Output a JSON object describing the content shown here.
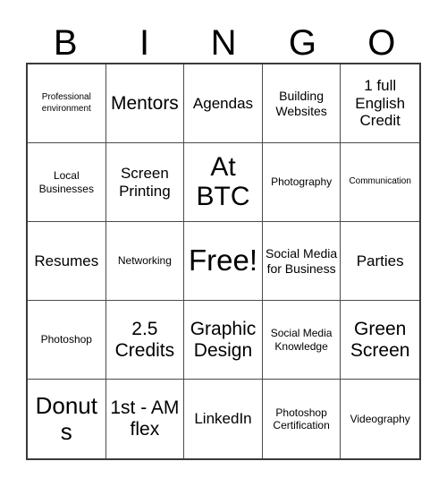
{
  "card": {
    "type": "bingo-card",
    "columns": 5,
    "rows": 5,
    "background_color": "#ffffff",
    "text_color": "#000000",
    "border_color": "#4a4a4a",
    "outer_border_color": "#3a3a3a",
    "header": {
      "letters": [
        "B",
        "I",
        "N",
        "G",
        "O"
      ]
    },
    "free_space": {
      "label": "Free!",
      "row": 3,
      "column": 3
    },
    "cells": [
      {
        "text": "Professional environment",
        "size": "sz-xs",
        "row": 1,
        "column": 1,
        "column_letter": "B"
      },
      {
        "text": "Mentors",
        "size": "sz-xl",
        "row": 1,
        "column": 2,
        "column_letter": "I"
      },
      {
        "text": "Agendas",
        "size": "sz-l",
        "row": 1,
        "column": 3,
        "column_letter": "N"
      },
      {
        "text": "Building Websites",
        "size": "sz-m",
        "row": 1,
        "column": 4,
        "column_letter": "G"
      },
      {
        "text": "1 full English Credit",
        "size": "sz-l",
        "row": 1,
        "column": 5,
        "column_letter": "O"
      },
      {
        "text": "Local Businesses",
        "size": "sz-s",
        "row": 2,
        "column": 1,
        "column_letter": "B"
      },
      {
        "text": "Screen Printing",
        "size": "sz-l",
        "row": 2,
        "column": 2,
        "column_letter": "I"
      },
      {
        "text": "At BTC",
        "size": "sz-3xl",
        "row": 2,
        "column": 3,
        "column_letter": "N"
      },
      {
        "text": "Photography",
        "size": "sz-s",
        "row": 2,
        "column": 4,
        "column_letter": "G"
      },
      {
        "text": "Communication",
        "size": "sz-xs",
        "row": 2,
        "column": 5,
        "column_letter": "O"
      },
      {
        "text": "Resumes",
        "size": "sz-l",
        "row": 3,
        "column": 1,
        "column_letter": "B"
      },
      {
        "text": "Networking",
        "size": "sz-s",
        "row": 3,
        "column": 2,
        "column_letter": "I"
      },
      {
        "text": "Free!",
        "size": "sz-4xl",
        "row": 3,
        "column": 3,
        "column_letter": "N"
      },
      {
        "text": "Social Media for Business",
        "size": "sz-m",
        "row": 3,
        "column": 4,
        "column_letter": "G"
      },
      {
        "text": "Parties",
        "size": "sz-l",
        "row": 3,
        "column": 5,
        "column_letter": "O"
      },
      {
        "text": "Photoshop",
        "size": "sz-s",
        "row": 4,
        "column": 1,
        "column_letter": "B"
      },
      {
        "text": "2.5 Credits",
        "size": "sz-xl",
        "row": 4,
        "column": 2,
        "column_letter": "I"
      },
      {
        "text": "Graphic Design",
        "size": "sz-xl",
        "row": 4,
        "column": 3,
        "column_letter": "N"
      },
      {
        "text": "Social Media Knowledge",
        "size": "sz-s",
        "row": 4,
        "column": 4,
        "column_letter": "G"
      },
      {
        "text": "Green Screen",
        "size": "sz-xl",
        "row": 4,
        "column": 5,
        "column_letter": "O"
      },
      {
        "text": "Donuts",
        "size": "sz-xxl",
        "row": 5,
        "column": 1,
        "column_letter": "B"
      },
      {
        "text": "1st - AM flex",
        "size": "sz-xl",
        "row": 5,
        "column": 2,
        "column_letter": "I"
      },
      {
        "text": "LinkedIn",
        "size": "sz-l",
        "row": 5,
        "column": 3,
        "column_letter": "N"
      },
      {
        "text": "Photoshop Certification",
        "size": "sz-s",
        "row": 5,
        "column": 4,
        "column_letter": "G"
      },
      {
        "text": "Videography",
        "size": "sz-s",
        "row": 5,
        "column": 5,
        "column_letter": "O"
      }
    ]
  }
}
